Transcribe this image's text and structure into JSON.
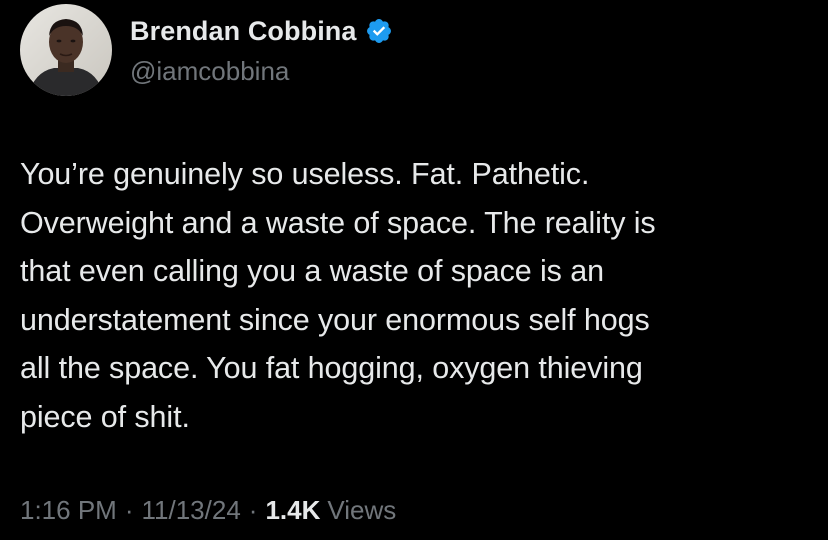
{
  "author": {
    "display_name": "Brendan Cobbina",
    "handle": "@iamcobbina",
    "verified_icon": "verified-badge-icon",
    "verified_color": "#1d9bf0"
  },
  "tweet": {
    "lines": "You’re genuinely so useless. Fat. Pathetic.\nOverweight and a waste of space. The reality is\nthat even calling you a waste of space is an\nunderstatement since your enormous self hogs\nall the space. You fat hogging, oxygen thieving\npiece of shit."
  },
  "meta": {
    "time": "1:16 PM",
    "separator": "·",
    "date": "11/13/24",
    "views_count": "1.4K",
    "views_label": "Views"
  },
  "colors": {
    "background": "#000000",
    "primary_text": "#e7e9ea",
    "secondary_text": "#71767b"
  }
}
